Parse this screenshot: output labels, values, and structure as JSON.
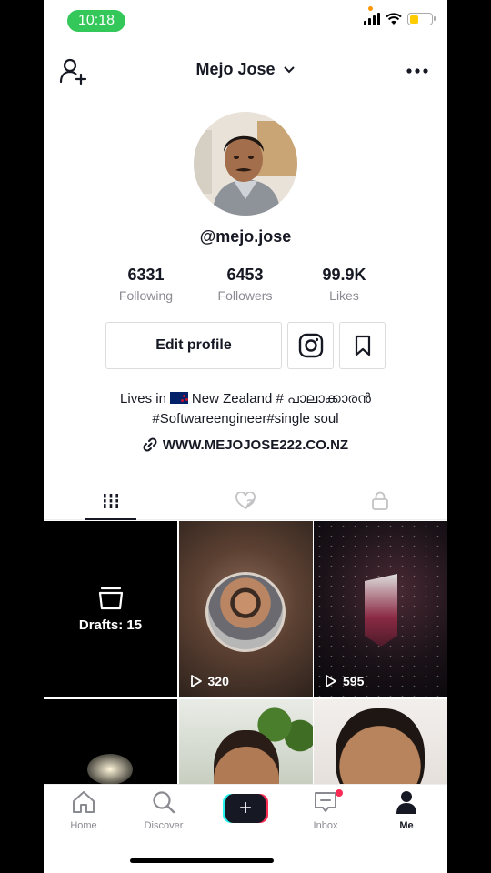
{
  "status_bar": {
    "time": "10:18"
  },
  "header": {
    "username": "Mejo Jose"
  },
  "profile": {
    "handle": "@mejo.jose",
    "stats": [
      {
        "value": "6331",
        "label": "Following"
      },
      {
        "value": "6453",
        "label": "Followers"
      },
      {
        "value": "99.9K",
        "label": "Likes"
      }
    ],
    "edit_label": "Edit profile",
    "bio_line1_pre": "Lives in",
    "bio_line1_post": "New Zealand # പാലാക്കാരൻ",
    "bio_line2": "#Softwareengineer#single soul",
    "link": "WWW.MEJOJOSE222.CO.NZ"
  },
  "drafts_label": "Drafts: 15",
  "videos": [
    {
      "plays": "320"
    },
    {
      "plays": "595"
    }
  ],
  "nav": {
    "home": "Home",
    "discover": "Discover",
    "create": "+",
    "inbox": "Inbox",
    "me": "Me"
  },
  "colors": {
    "status_pill": "#34c759",
    "battery": "#ffcc00",
    "accent_red": "#fe2c55",
    "accent_cyan": "#25f4ee"
  }
}
